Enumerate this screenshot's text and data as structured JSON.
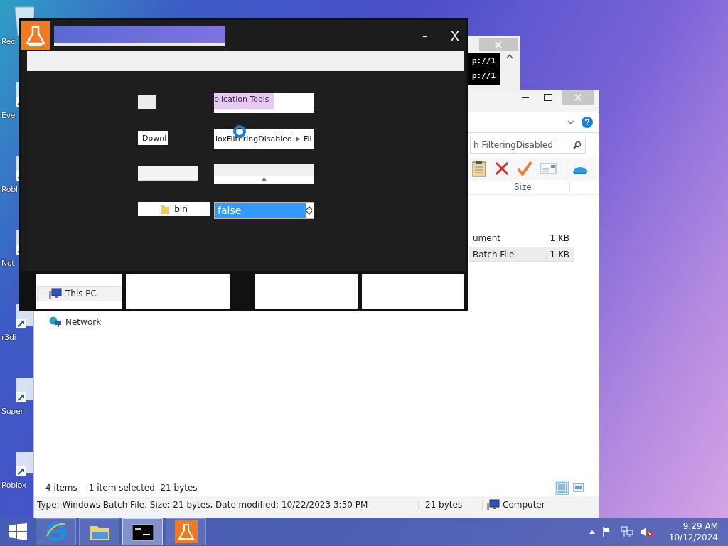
{
  "desktop_icons": [
    {
      "kind": "bin",
      "label": "Rec"
    },
    {
      "kind": "shortcut",
      "label": "Eve"
    },
    {
      "kind": "shortcut",
      "label": "Robl"
    },
    {
      "kind": "shortcut",
      "label": "Not"
    },
    {
      "kind": "shortcut",
      "label": "r3di"
    },
    {
      "kind": "shortcut",
      "label": "Super"
    },
    {
      "kind": "shortcut",
      "label": "Roblox"
    }
  ],
  "console_window": {
    "lines": [
      "p://1",
      "p://1"
    ]
  },
  "explorer": {
    "help": "?",
    "search": {
      "value": "h FilteringDisabled"
    },
    "columns": [
      "Size"
    ],
    "files": [
      {
        "name": "ument",
        "size": "1 KB",
        "selected": false
      },
      {
        "name": "Batch File",
        "size": "1 KB",
        "selected": true
      }
    ],
    "nav": [
      {
        "kind": "pc",
        "label": "This PC",
        "selected": true
      },
      {
        "kind": "network",
        "label": "Network",
        "selected": false
      }
    ],
    "status": {
      "items": "4 items",
      "selection": "1 item selected  21 bytes"
    },
    "views": [
      {
        "kind": "details",
        "selected": true
      },
      {
        "kind": "tiles",
        "selected": false
      }
    ],
    "details_bar": {
      "info": "Type: Windows Batch File, Size: 21 bytes, Date modified: 10/22/2023 3:50 PM",
      "size": "21 bytes",
      "location": "Computer"
    }
  },
  "app_window": {
    "minimize": "–",
    "close": "X",
    "fields": [
      {
        "kind": "blank"
      },
      {
        "kind": "highlight",
        "value": "plication Tools"
      },
      {
        "kind": "text",
        "value": "Downl"
      },
      {
        "kind": "breadcrumb",
        "parts": [
          "loxFilteringDisabled",
          "Fil"
        ]
      },
      {
        "kind": "blank-wide"
      },
      {
        "kind": "caret"
      },
      {
        "kind": "folder",
        "label": "bin"
      },
      {
        "kind": "spin",
        "value": "false",
        "selected": true
      }
    ]
  },
  "taskbar": {
    "apps": [
      {
        "kind": "browser",
        "active": false
      },
      {
        "kind": "folder",
        "active": false
      },
      {
        "kind": "console",
        "active": true
      },
      {
        "kind": "flask",
        "active": false
      }
    ],
    "clock": {
      "time": "9:29 AM",
      "date": "10/12/2024"
    }
  }
}
